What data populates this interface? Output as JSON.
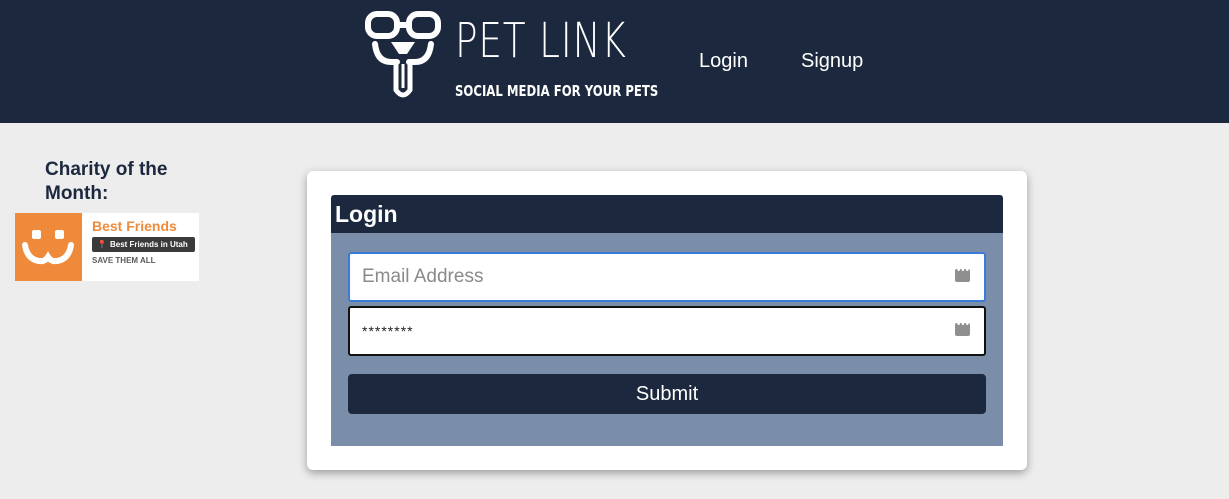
{
  "header": {
    "logo_title": "PET LINK",
    "logo_tagline": "SOCIAL MEDIA FOR YOUR PETS",
    "nav": [
      {
        "label": "Login"
      },
      {
        "label": "Signup"
      }
    ]
  },
  "sidebar": {
    "charity_heading": "Charity of the Month:",
    "charity": {
      "name": "Best Friends",
      "location": "Best Friends in Utah",
      "slogan": "SAVE THEM ALL"
    }
  },
  "login_form": {
    "title": "Login",
    "email_placeholder": "Email Address",
    "password_value": "********",
    "submit_label": "Submit"
  },
  "colors": {
    "navbar": "#1c283d",
    "form_body": "#7b8ea9",
    "charity_orange": "#f08a3b",
    "focus_border": "#3b7bd8"
  }
}
